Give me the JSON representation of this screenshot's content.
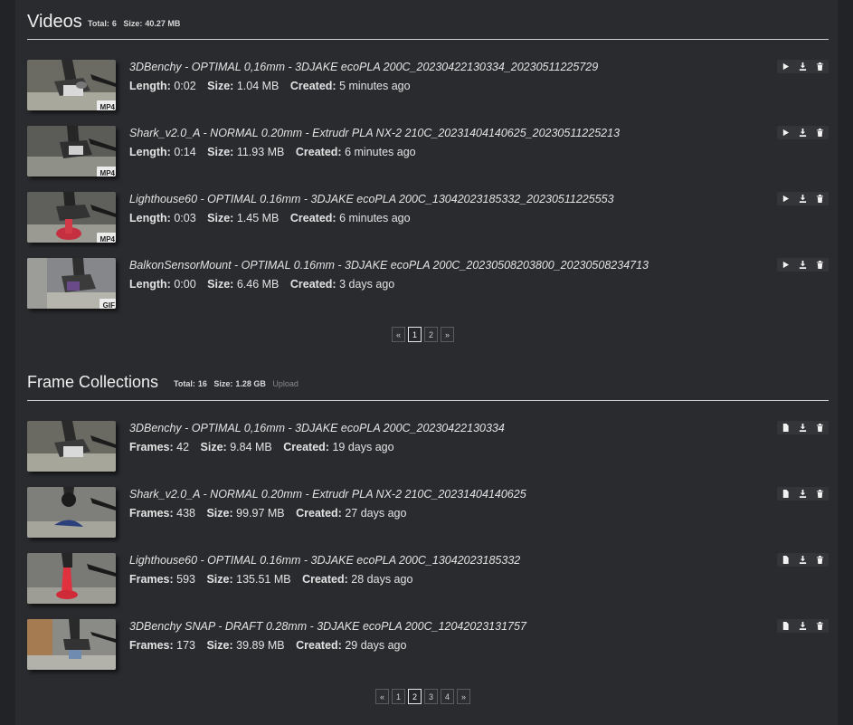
{
  "videos": {
    "title": "Videos",
    "total_label": "Total:",
    "total": "6",
    "size_label": "Size:",
    "size": "40.27 MB",
    "items": [
      {
        "name": "3DBenchy - OPTIMAL 0,16mm - 3DJAKE ecoPLA 200C_20230422130334_20230511225729",
        "length": "0:02",
        "size": "1.04 MB",
        "created": "5 minutes ago",
        "format": "MP4"
      },
      {
        "name": "Shark_v2.0_A - NORMAL 0.20mm - Extrudr PLA NX-2 210C_20231404140625_20230511225213",
        "length": "0:14",
        "size": "11.93 MB",
        "created": "6 minutes ago",
        "format": "MP4"
      },
      {
        "name": "Lighthouse60 - OPTIMAL 0.16mm - 3DJAKE ecoPLA 200C_13042023185332_20230511225553",
        "length": "0:03",
        "size": "1.45 MB",
        "created": "6 minutes ago",
        "format": "MP4"
      },
      {
        "name": "BalkonSensorMount - OPTIMAL 0.16mm - 3DJAKE ecoPLA 200C_20230508203800_20230508234713",
        "length": "0:00",
        "size": "6.46 MB",
        "created": "3 days ago",
        "format": "GIF"
      }
    ],
    "labels": {
      "length": "Length:",
      "size": "Size:",
      "created": "Created:"
    },
    "pager": {
      "prev": "«",
      "pages": [
        "1",
        "2"
      ],
      "next": "»",
      "current": "1"
    }
  },
  "frames": {
    "title": "Frame Collections",
    "total_label": "Total:",
    "total": "16",
    "size_label": "Size:",
    "size": "1.28 GB",
    "upload": "Upload",
    "items": [
      {
        "name": "3DBenchy - OPTIMAL 0,16mm - 3DJAKE ecoPLA 200C_20230422130334",
        "frames": "42",
        "size": "9.84 MB",
        "created": "19 days ago"
      },
      {
        "name": "Shark_v2.0_A - NORMAL 0.20mm - Extrudr PLA NX-2 210C_20231404140625",
        "frames": "438",
        "size": "99.97 MB",
        "created": "27 days ago"
      },
      {
        "name": "Lighthouse60 - OPTIMAL 0.16mm - 3DJAKE ecoPLA 200C_13042023185332",
        "frames": "593",
        "size": "135.51 MB",
        "created": "28 days ago"
      },
      {
        "name": "3DBenchy SNAP - DRAFT 0.28mm - 3DJAKE ecoPLA 200C_12042023131757",
        "frames": "173",
        "size": "39.89 MB",
        "created": "29 days ago"
      }
    ],
    "labels": {
      "frames": "Frames:",
      "size": "Size:",
      "created": "Created:"
    },
    "pager": {
      "prev": "«",
      "pages": [
        "1",
        "2",
        "3",
        "4"
      ],
      "next": "»",
      "current": "2"
    }
  }
}
